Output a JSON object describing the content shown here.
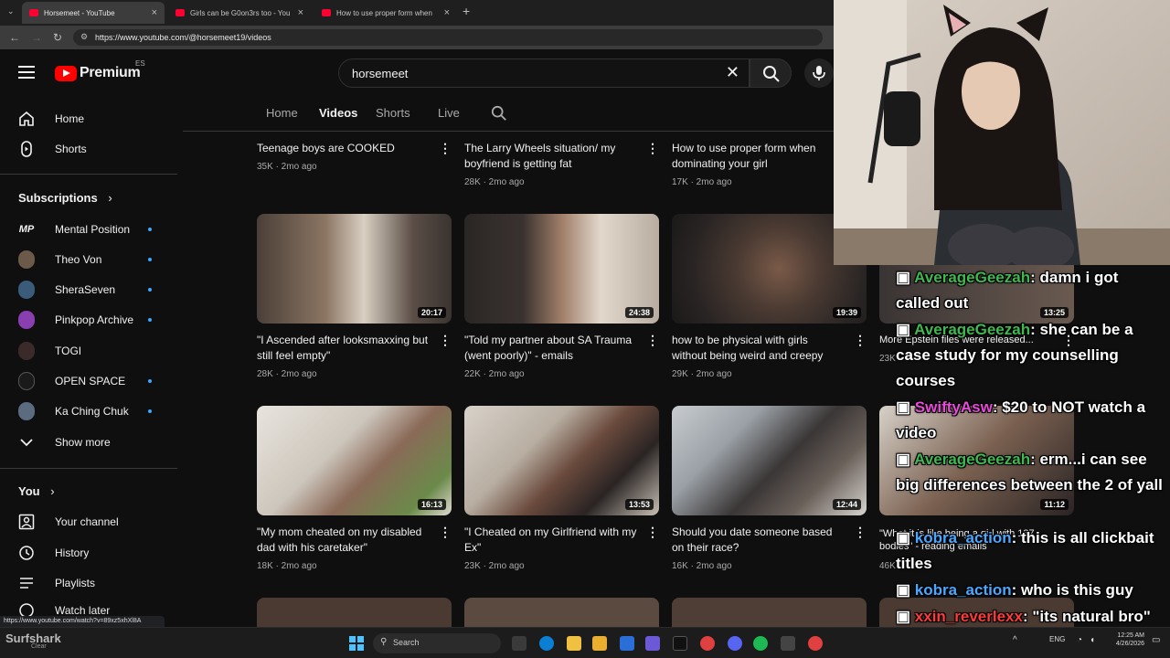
{
  "browser": {
    "tabs": [
      {
        "title": "Horsemeet - YouTube"
      },
      {
        "title": "Girls can be G0on3rs too - You"
      },
      {
        "title": "How to use proper form when"
      }
    ],
    "url": "https://www.youtube.com/@horsemeet19/videos",
    "status_url": "https://www.youtube.com/watch?v=89xz5xhXl8A"
  },
  "header": {
    "logo_text": "Premium",
    "region": "ES",
    "search_value": "horsemeet"
  },
  "sidebar": {
    "main": [
      {
        "label": "Home",
        "icon": "home-icon"
      },
      {
        "label": "Shorts",
        "icon": "shorts-icon"
      }
    ],
    "subscriptions_heading": "Subscriptions",
    "subscriptions": [
      {
        "label": "Mental Position",
        "avatar": "MP"
      },
      {
        "label": "Theo Von"
      },
      {
        "label": "SheraSeven"
      },
      {
        "label": "Pinkpop Archive"
      },
      {
        "label": "TOGI"
      },
      {
        "label": "OPEN SPACE"
      },
      {
        "label": "Ka Ching Chuk"
      }
    ],
    "show_more": "Show more",
    "you_heading": "You",
    "you_items": [
      {
        "label": "Your channel"
      },
      {
        "label": "History"
      },
      {
        "label": "Playlists"
      },
      {
        "label": "Watch later"
      }
    ]
  },
  "channel_tabs": [
    "Home",
    "Videos",
    "Shorts",
    "Live"
  ],
  "videos_row0": [
    {
      "title": "Teenage boys are COOKED",
      "meta": "35K · 2mo ago"
    },
    {
      "title": "The Larry Wheels situation/ my boyfriend is getting fat",
      "meta": "28K · 2mo ago"
    },
    {
      "title": "How to use proper form when dominating your girl",
      "meta": "17K · 2mo ago"
    }
  ],
  "videos_row1": [
    {
      "title": "\"I Ascended after looksmaxxing but still feel empty\"",
      "meta": "28K · 2mo ago",
      "duration": "20:17"
    },
    {
      "title": "\"Told my partner about SA Trauma (went poorly)\" - emails",
      "meta": "22K · 2mo ago",
      "duration": "24:38"
    },
    {
      "title": "how to be physical with girls without being weird and creepy",
      "meta": "29K · 2mo ago",
      "duration": "19:39"
    },
    {
      "title": "More Epstein files were released...",
      "meta": "23K",
      "duration": "13:25"
    }
  ],
  "videos_row2": [
    {
      "title": "\"My mom cheated on my disabled dad with his caretaker\"",
      "meta": "18K · 2mo ago",
      "duration": "16:13"
    },
    {
      "title": "\"I Cheated on my Girlfriend with my Ex\"",
      "meta": "23K · 2mo ago",
      "duration": "13:53"
    },
    {
      "title": "Should you date someone based on their race?",
      "meta": "16K · 2mo ago",
      "duration": "12:44"
    },
    {
      "title": "\"What it is like being a girl with 137 bodies\" - reading emails",
      "meta": "46K",
      "duration": "11:12"
    }
  ],
  "chat": [
    {
      "user": "AverageGeezah",
      "text": ": damn i got called out",
      "color": "#3fb950"
    },
    {
      "user": "AverageGeezah",
      "text": ": she can be a case study for my counselling courses",
      "color": "#3fb950"
    },
    {
      "user": "SwiftyAsw",
      "text": ": $20 to NOT watch a video",
      "color": "#e84bd8"
    },
    {
      "user": "AverageGeezah",
      "text": ": erm...i can see big differences between the 2 of yall",
      "color": "#3fb950"
    },
    {
      "user": "kobra_action",
      "text": ": this is all clickbait titles",
      "color": "#4aa8ff"
    },
    {
      "user": "kobra_action",
      "text": ": who is this guy",
      "color": "#4aa8ff"
    },
    {
      "user": "xxin_reverlexx",
      "text": ": \"its natural bro\"",
      "color": "#ff3b3b"
    }
  ],
  "taskbar": {
    "search_placeholder": "Search",
    "widget_text": "Surfshark",
    "widget_sub": "Clear",
    "lang": "ENG",
    "time": "12:25 AM",
    "date": "4/26/2026"
  },
  "colors": {
    "accent": "#ff0000",
    "link_blue": "#3ea6ff",
    "bg": "#0f0f0f"
  }
}
